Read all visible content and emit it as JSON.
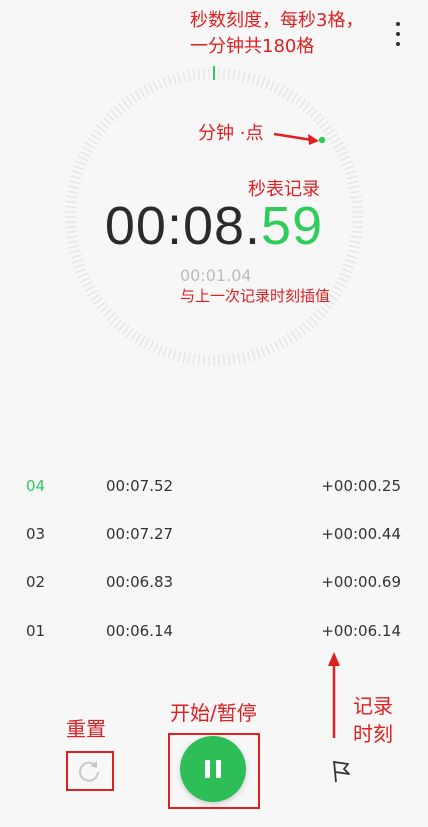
{
  "annotations": {
    "dial_note_line1": "秒数刻度，每秒3格，",
    "dial_note_line2": "一分钟共180格",
    "minute_dot_note": "分钟 ·点",
    "stopwatch_record_note": "秒表记录",
    "lap_interp_note": "与上一次记录时刻插值",
    "record_time_line1": "记录",
    "record_time_line2": "时刻",
    "reset_note": "重置",
    "start_pause_note": "开始/暂停"
  },
  "stopwatch": {
    "main": "00:08.",
    "centis": "59",
    "current_lap": "00:01.04"
  },
  "laps": [
    {
      "no": "04",
      "time": "00:07.52",
      "diff": "+00:00.25"
    },
    {
      "no": "03",
      "time": "00:07.27",
      "diff": "+00:00.44"
    },
    {
      "no": "02",
      "time": "00:06.83",
      "diff": "+00:00.69"
    },
    {
      "no": "01",
      "time": "00:06.14",
      "diff": "+00:06.14"
    }
  ],
  "colors": {
    "accent": "#2ecc5b",
    "annotation": "#e02020"
  }
}
